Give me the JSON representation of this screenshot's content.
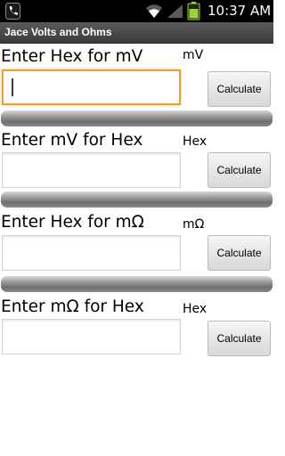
{
  "status_bar": {
    "time": "10:37 AM",
    "icons": [
      "phone-icon",
      "wifi-icon",
      "signal-icon",
      "battery-icon"
    ]
  },
  "app": {
    "title": "Jace Volts and Ohms"
  },
  "sections": [
    {
      "prompt": "Enter Hex for mV",
      "unit": "mV",
      "input_value": "",
      "button": "Calculate",
      "focused": true
    },
    {
      "prompt": "Enter mV for Hex",
      "unit": "Hex",
      "input_value": "",
      "button": "Calculate",
      "focused": false
    },
    {
      "prompt": "Enter Hex for mΩ",
      "unit": "mΩ",
      "input_value": "",
      "button": "Calculate",
      "focused": false
    },
    {
      "prompt": "Enter mΩ for Hex",
      "unit": "Hex",
      "input_value": "",
      "button": "Calculate",
      "focused": false
    }
  ],
  "colors": {
    "status_bar": "#000000",
    "title_bar": "#4a4a4a",
    "focus_border": "#f0a030",
    "divider": "#8a8a8a"
  }
}
